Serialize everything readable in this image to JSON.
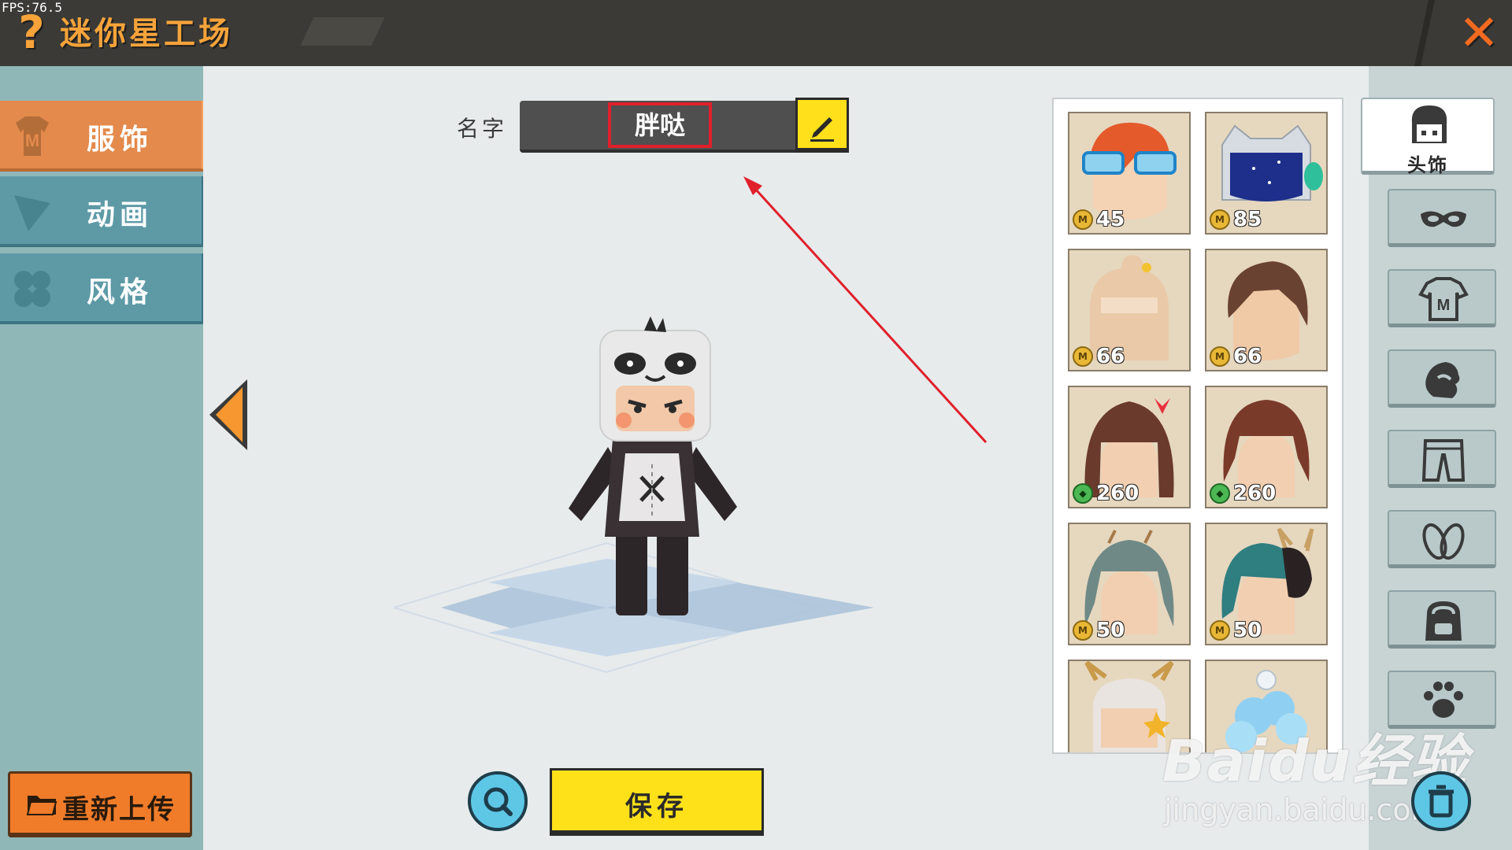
{
  "fps": "FPS:76.5",
  "header": {
    "title": "迷你星工场"
  },
  "sidebar": {
    "tabs": [
      {
        "label": "服饰",
        "active": true
      },
      {
        "label": "动画",
        "active": false
      },
      {
        "label": "风格",
        "active": false
      }
    ],
    "reupload_label": "重新上传"
  },
  "editor": {
    "name_label": "名字",
    "name_value": "胖哒",
    "save_label": "保存"
  },
  "items": [
    {
      "price": "45",
      "currency": "coin"
    },
    {
      "price": "85",
      "currency": "coin"
    },
    {
      "price": "66",
      "currency": "coin"
    },
    {
      "price": "66",
      "currency": "coin"
    },
    {
      "price": "260",
      "currency": "gem"
    },
    {
      "price": "260",
      "currency": "gem"
    },
    {
      "price": "50",
      "currency": "coin"
    },
    {
      "price": "50",
      "currency": "coin"
    },
    {
      "price": "",
      "currency": ""
    },
    {
      "price": "",
      "currency": ""
    }
  ],
  "categories": {
    "active_label": "头饰",
    "icons": [
      "mask-icon",
      "shirt-icon",
      "glove-icon",
      "pants-icon",
      "shoes-icon",
      "backpack-icon",
      "paw-icon"
    ]
  },
  "watermark": {
    "main": "Baidu经验",
    "sub": "jingyan.baidu.com"
  },
  "colors": {
    "accent_orange": "#e38a4c",
    "save_yellow": "#ffe11a",
    "highlight_red": "#e0202b"
  }
}
